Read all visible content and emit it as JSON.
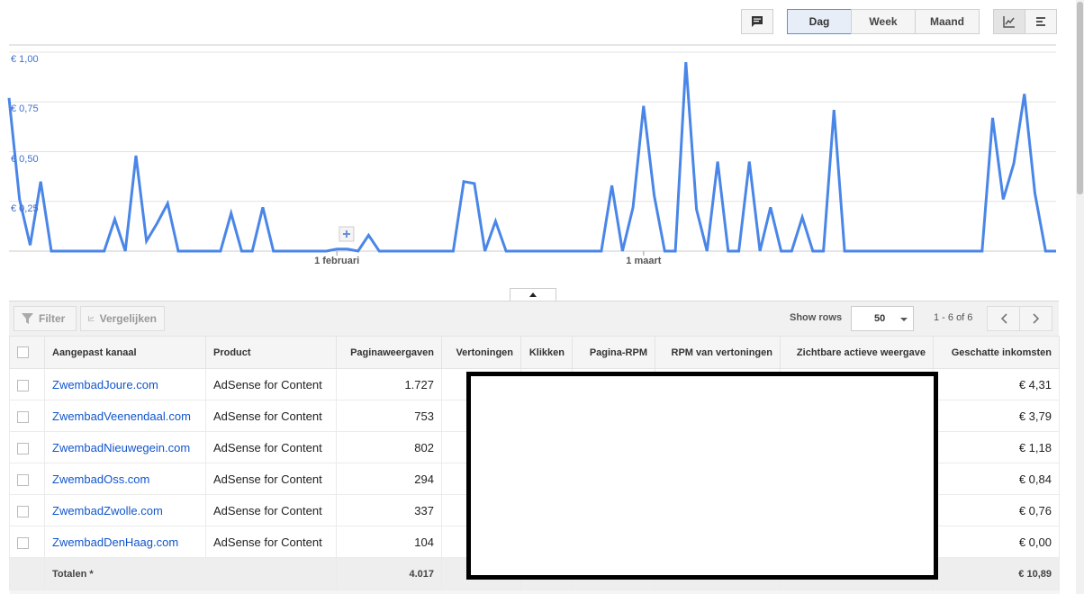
{
  "toolbar": {
    "comment_icon": "comment-icon",
    "periods": [
      "Dag",
      "Week",
      "Maand"
    ],
    "selected_period": "Dag",
    "view_icons": [
      "line-chart-icon",
      "table-chart-icon"
    ]
  },
  "chart_data": {
    "type": "line",
    "y_tick_labels": [
      "€ 1,00",
      "€ 0,75",
      "€ 0,50",
      "€ 0,25"
    ],
    "ylim": [
      0,
      1.0
    ],
    "x_tick_labels": [
      {
        "label": "1 februari",
        "index": 31
      },
      {
        "label": "1 maart",
        "index": 60
      }
    ],
    "x_start": "2016-01-01",
    "series": [
      {
        "color": "#4a86e8",
        "values": [
          0.77,
          0.26,
          0.03,
          0.35,
          0,
          0,
          0,
          0,
          0,
          0,
          0.16,
          0,
          0.48,
          0.05,
          0.14,
          0.24,
          0,
          0,
          0,
          0,
          0,
          0.19,
          0,
          0,
          0.22,
          0,
          0,
          0,
          0,
          0,
          0,
          0.01,
          0.01,
          0,
          0.08,
          0,
          0,
          0,
          0,
          0,
          0,
          0,
          0,
          0.35,
          0.34,
          0,
          0.15,
          0,
          0,
          0,
          0,
          0,
          0,
          0,
          0,
          0,
          0,
          0.33,
          0,
          0.22,
          0.73,
          0.28,
          0,
          0,
          0.95,
          0.21,
          0,
          0.45,
          0,
          0,
          0.45,
          0,
          0.22,
          0,
          0,
          0.17,
          0,
          0,
          0.71,
          0,
          0,
          0,
          0,
          0,
          0,
          0,
          0,
          0,
          0,
          0,
          0,
          0,
          0,
          0.67,
          0.26,
          0.44,
          0.79,
          0.29,
          0,
          0
        ]
      }
    ],
    "grid": true
  },
  "table_controls": {
    "filter_label": "Filter",
    "filter_icon": "funnel-icon",
    "compare_label": "Vergelijken",
    "compare_icon": "compare-chart-icon",
    "show_rows_label": "Show rows",
    "rows_value": "50",
    "page_info": "1 - 6 of 6"
  },
  "table": {
    "headers": [
      "Aangepast kanaal",
      "Product",
      "Paginaweergaven",
      "Vertoningen",
      "Klikken",
      "Pagina-RPM",
      "RPM van vertoningen",
      "Zichtbare actieve weergave",
      "Geschatte inkomsten"
    ],
    "rows": [
      {
        "kanaal": "ZwembadJoure.com",
        "product": "AdSense for Content",
        "weergaven": "1.727",
        "inkomsten": "€ 4,31"
      },
      {
        "kanaal": "ZwembadVeenendaal.com",
        "product": "AdSense for Content",
        "weergaven": "753",
        "inkomsten": "€ 3,79"
      },
      {
        "kanaal": "ZwembadNieuwegein.com",
        "product": "AdSense for Content",
        "weergaven": "802",
        "inkomsten": "€ 1,18"
      },
      {
        "kanaal": "ZwembadOss.com",
        "product": "AdSense for Content",
        "weergaven": "294",
        "inkomsten": "€ 0,84"
      },
      {
        "kanaal": "ZwembadZwolle.com",
        "product": "AdSense for Content",
        "weergaven": "337",
        "inkomsten": "€ 0,76"
      },
      {
        "kanaal": "ZwembadDenHaag.com",
        "product": "AdSense for Content",
        "weergaven": "104",
        "inkomsten": "€ 0,00"
      }
    ],
    "total": {
      "label": "Totalen *",
      "weergaven": "4.017",
      "inkomsten": "€ 10,89"
    }
  }
}
